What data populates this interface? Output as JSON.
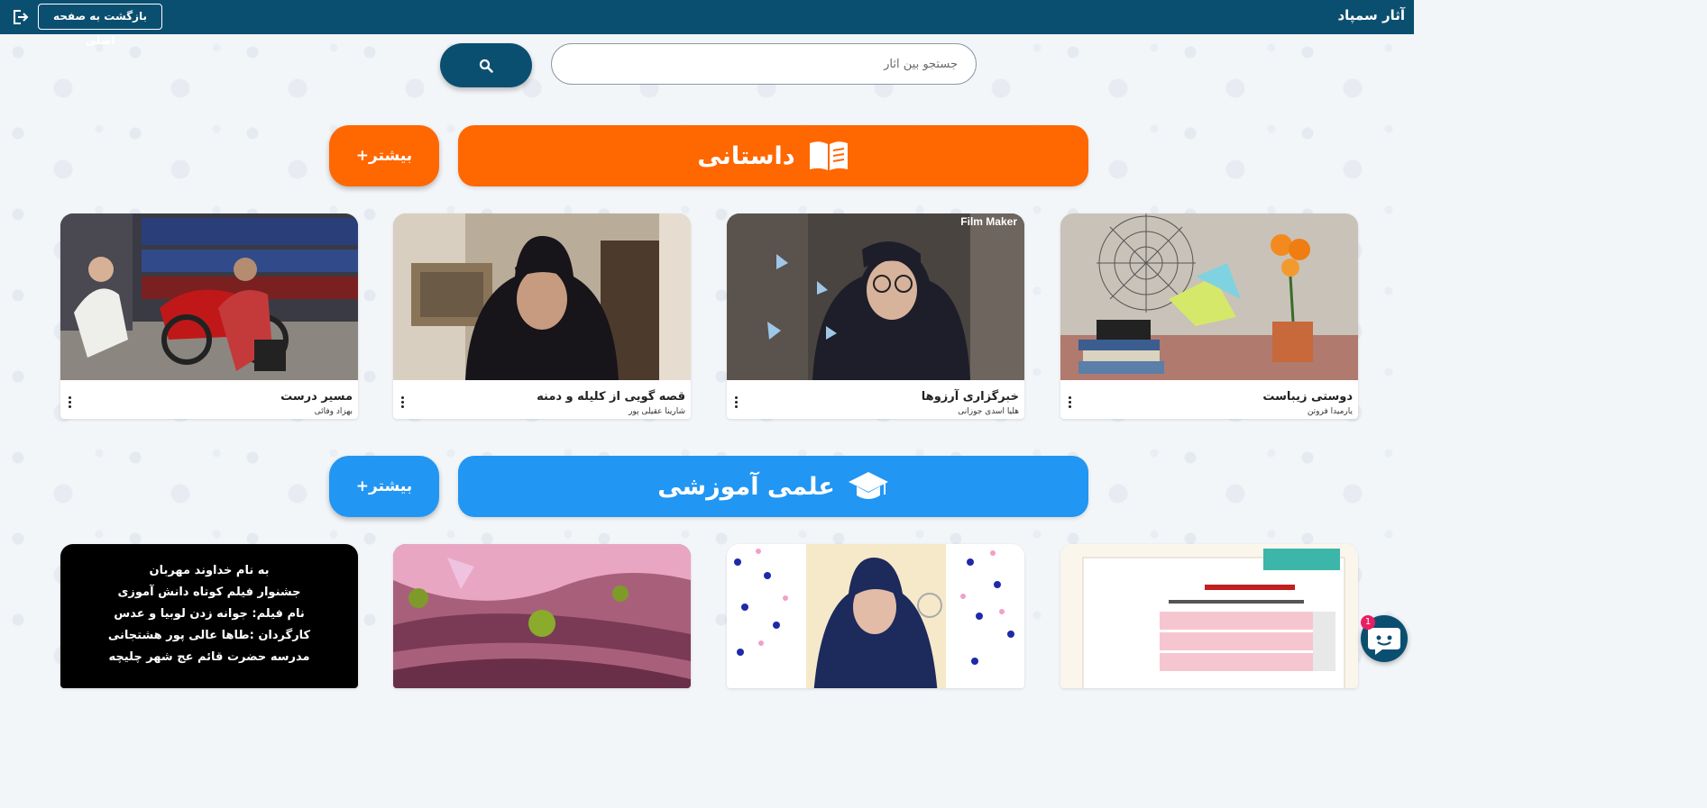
{
  "header": {
    "site_title": "آثار سمپاد",
    "back_button_label": "بازگشت به صفحه اصلی",
    "exit_icon": "logout-icon"
  },
  "search": {
    "placeholder": "جستجو بین آثار",
    "value": "",
    "button_icon": "search-icon"
  },
  "categories": [
    {
      "title": "داستانی",
      "icon": "book-icon",
      "more_label": "بیشتر+",
      "color": "#ff6700",
      "items": [
        {
          "title": "دوستی زیباست",
          "author": "یارمیدا فروتن"
        },
        {
          "title": "خبرگزاری آرزوها",
          "author": "هلیا اسدی جوزانی",
          "watermark": "Film Maker"
        },
        {
          "title": "قصه گویی از کلیله و دمنه",
          "author": "شارینا عقیلی پور"
        },
        {
          "title": "مسیر درست",
          "author": "بهزاد وفائی"
        }
      ]
    },
    {
      "title": "علمی آموزشی",
      "icon": "graduation-cap-icon",
      "more_label": "بیشتر+",
      "color": "#2196f3",
      "items": [
        {
          "title": "",
          "author": "",
          "poster_lines": []
        },
        {
          "title": "",
          "author": ""
        },
        {
          "title": "",
          "author": ""
        },
        {
          "title": "",
          "author": "",
          "poster_lines": [
            "به نام خداوند مهربان",
            "جشنوار فیلم کوتاه دانش آموزی",
            "نام فیلم: جوانه زدن لوبیا و عدس",
            "کارگردان :طاها عالی پور هشتجانی",
            "مدرسه حضرت قائم عج شهر چلیچه"
          ]
        }
      ]
    }
  ],
  "chat": {
    "icon": "chat-icon",
    "badge_count": "1"
  },
  "colors": {
    "header_bg": "#0b4f70",
    "story_orange": "#ff6700",
    "science_blue": "#2196f3",
    "badge_pink": "#e91e63"
  }
}
